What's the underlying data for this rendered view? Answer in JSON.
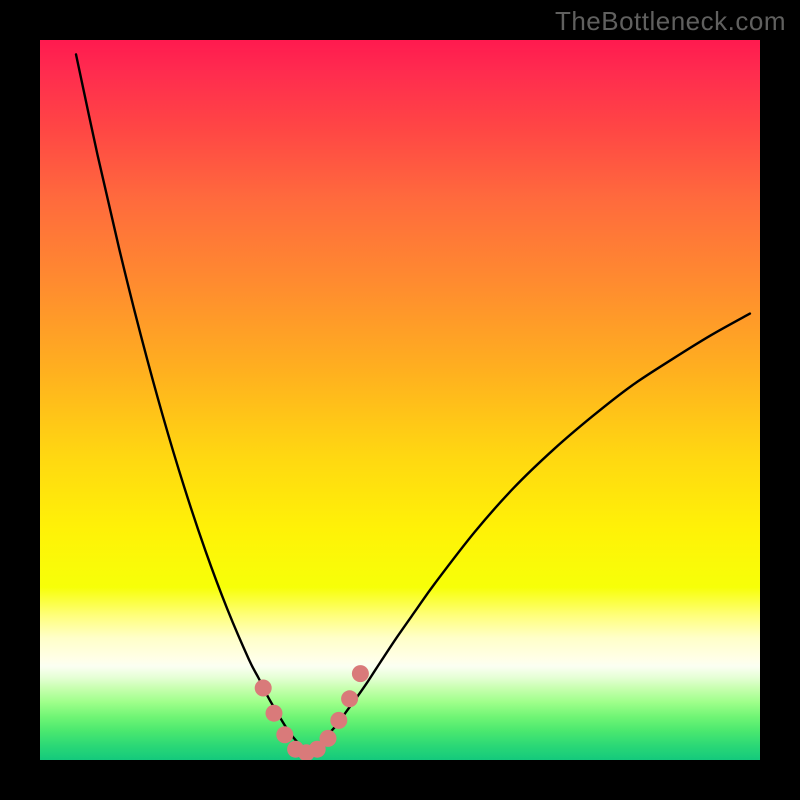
{
  "watermark": "TheBottleneck.com",
  "chart_data": {
    "type": "line",
    "title": "",
    "xlabel": "",
    "ylabel": "",
    "xlim": [
      0,
      100
    ],
    "ylim": [
      0,
      100
    ],
    "series": [
      {
        "name": "curve-left",
        "x": [
          5,
          8,
          11,
          14,
          17,
          20,
          23,
          26,
          29,
          30.4,
          31.7,
          33.1,
          34.4,
          35.8,
          37.2
        ],
        "y": [
          98,
          84,
          71,
          59,
          48,
          38,
          29,
          21,
          14,
          11.3,
          8.7,
          6.3,
          4.2,
          2.4,
          1
        ]
      },
      {
        "name": "curve-right",
        "x": [
          37.2,
          38.6,
          39.9,
          41.3,
          42.6,
          44,
          45.4,
          46.7,
          49.4,
          52.2,
          54.9,
          60.4,
          65.8,
          71.3,
          76.8,
          82.2,
          87.7,
          93.2,
          98.6
        ],
        "y": [
          1,
          2,
          3.4,
          5,
          6.8,
          8.7,
          10.7,
          12.7,
          16.8,
          20.8,
          24.6,
          31.7,
          37.8,
          43.1,
          47.8,
          52,
          55.6,
          59,
          62
        ]
      }
    ],
    "markers": {
      "name": "highlight-dots",
      "color": "#d97a7a",
      "x": [
        31,
        32.5,
        34,
        35.5,
        37,
        38.5,
        40,
        41.5,
        43,
        44.5
      ],
      "y": [
        10,
        6.5,
        3.5,
        1.5,
        1,
        1.5,
        3,
        5.5,
        8.5,
        12
      ]
    },
    "background": {
      "type": "vertical-gradient",
      "stops": [
        {
          "pos": 0.0,
          "color": "#ff1a4f"
        },
        {
          "pos": 0.04,
          "color": "#ff2a4f"
        },
        {
          "pos": 0.12,
          "color": "#ff4545"
        },
        {
          "pos": 0.22,
          "color": "#ff6a3d"
        },
        {
          "pos": 0.34,
          "color": "#ff8c2f"
        },
        {
          "pos": 0.46,
          "color": "#ffb01f"
        },
        {
          "pos": 0.58,
          "color": "#ffd811"
        },
        {
          "pos": 0.68,
          "color": "#fff207"
        },
        {
          "pos": 0.76,
          "color": "#f7ff08"
        },
        {
          "pos": 0.8,
          "color": "#ffff7d"
        },
        {
          "pos": 0.83,
          "color": "#ffffc8"
        },
        {
          "pos": 0.86,
          "color": "#ffffe8"
        },
        {
          "pos": 0.87,
          "color": "#fbfff2"
        },
        {
          "pos": 0.885,
          "color": "#e6ffd6"
        },
        {
          "pos": 0.9,
          "color": "#c8ffb0"
        },
        {
          "pos": 0.92,
          "color": "#9eff8a"
        },
        {
          "pos": 0.94,
          "color": "#70f575"
        },
        {
          "pos": 0.96,
          "color": "#4ae86f"
        },
        {
          "pos": 0.98,
          "color": "#2bd876"
        },
        {
          "pos": 1.0,
          "color": "#14c97c"
        }
      ]
    }
  }
}
